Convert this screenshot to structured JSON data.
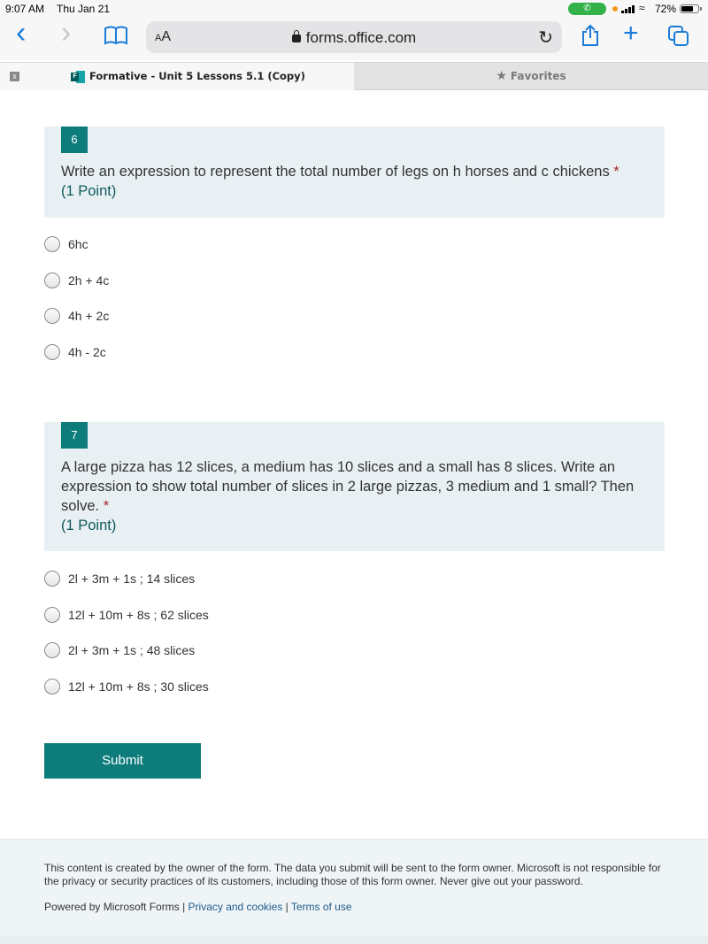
{
  "status_bar": {
    "time": "9:07 AM",
    "date": "Thu Jan 21",
    "call_icon": "phone-icon",
    "battery_percent": "72%",
    "battery_level": 0.72
  },
  "browser": {
    "back_icon": "‹",
    "forward_icon": "›",
    "bookmarks_icon": "book-icon",
    "text_size_label_small": "A",
    "text_size_label_large": "A",
    "url": "forms.office.com",
    "reload_icon": "↻",
    "share_icon": "share-icon",
    "new_tab_icon": "+",
    "tabs_icon": "tabs-icon"
  },
  "tabs": {
    "active_title": "Formative - Unit 5 Lessons 5.1 (Copy)",
    "close_label": "x",
    "favorites_label": "Favorites"
  },
  "questions": [
    {
      "number": "6",
      "text": "Write an expression to represent the total number of legs on h horses and c chickens",
      "required_mark": "*",
      "points": "(1 Point)",
      "options": [
        "6hc",
        "2h + 4c",
        "4h + 2c",
        "4h - 2c"
      ]
    },
    {
      "number": "7",
      "text": "A large pizza has 12 slices, a medium has 10 slices and a small has 8 slices. Write an expression to show total number of slices in 2 large pizzas, 3 medium and 1 small? Then solve.",
      "required_mark": "*",
      "points": "(1 Point)",
      "options": [
        "2l + 3m + 1s ; 14 slices",
        "12l + 10m + 8s ; 62 slices",
        "2l + 3m + 1s ; 48 slices",
        "12l + 10m + 8s ; 30 slices"
      ]
    }
  ],
  "submit_label": "Submit",
  "footer": {
    "disclaimer": "This content is created by the owner of the form. The data you submit will be sent to the form owner. Microsoft is not responsible for the privacy or security practices of its customers, including those of this form owner. Never give out your password.",
    "powered_by": "Powered by Microsoft Forms",
    "separator": "|",
    "privacy_link": "Privacy and cookies",
    "terms_link": "Terms of use"
  },
  "colors": {
    "accent": "#0e7c7b",
    "question_bg": "#e9f0f3",
    "required": "#a4262c",
    "link": "#1e5c8a",
    "browser_blue": "#1a7cd8"
  }
}
